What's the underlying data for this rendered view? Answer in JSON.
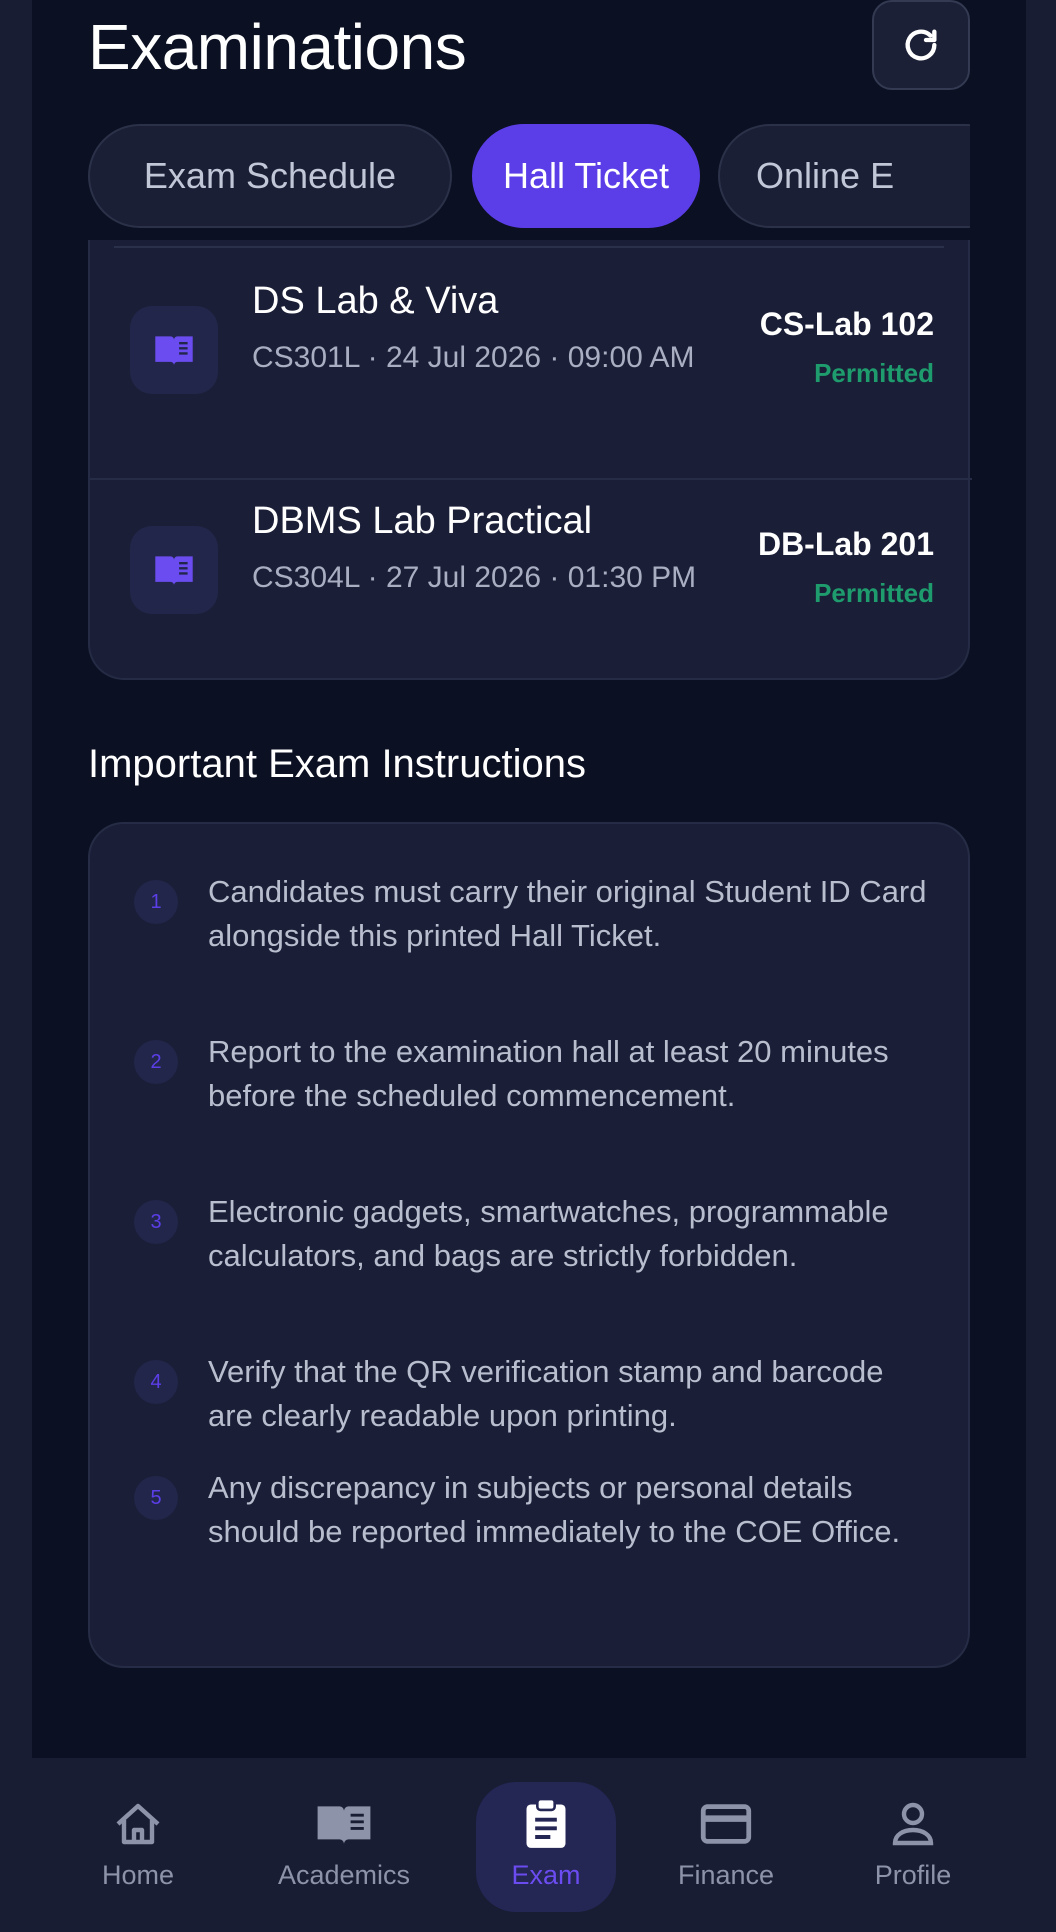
{
  "header": {
    "title": "Examinations",
    "refresh_icon": "refresh-icon"
  },
  "tabs": [
    {
      "label": "Exam Schedule",
      "active": false
    },
    {
      "label": "Hall Ticket",
      "active": true
    },
    {
      "label": "Online E",
      "active": false
    }
  ],
  "exams": [
    {
      "name": "DS Lab & Viva",
      "meta": "CS301L · 24 Jul 2026 · 09:00 AM",
      "room": "CS-Lab 102",
      "status": "Permitted",
      "icon": "book-icon"
    },
    {
      "name": "DBMS Lab Practical",
      "meta": "CS304L · 27 Jul 2026 · 01:30 PM",
      "room": "DB-Lab 201",
      "status": "Permitted",
      "icon": "book-icon"
    }
  ],
  "instructions": {
    "title": "Important Exam Instructions",
    "items": [
      {
        "num": "1",
        "text": "Candidates must carry their original Student ID Card alongside this printed Hall Ticket."
      },
      {
        "num": "2",
        "text": "Report to the examination hall at least 20 minutes before the scheduled commencement."
      },
      {
        "num": "3",
        "text": "Electronic gadgets, smartwatches, programmable calculators, and bags are strictly forbidden."
      },
      {
        "num": "4",
        "text": "Verify that the QR verification stamp and barcode are clearly readable upon printing."
      },
      {
        "num": "5",
        "text": "Any discrepancy in subjects or personal details should be reported immediately to the COE Office."
      }
    ]
  },
  "nav": [
    {
      "label": "Home",
      "icon": "home-icon",
      "active": false
    },
    {
      "label": "Academics",
      "icon": "book-icon",
      "active": false
    },
    {
      "label": "Exam",
      "icon": "clipboard-icon",
      "active": true
    },
    {
      "label": "Finance",
      "icon": "card-icon",
      "active": false
    },
    {
      "label": "Profile",
      "icon": "user-icon",
      "active": false
    }
  ],
  "colors": {
    "accent": "#5b3ee8",
    "permitted": "#1e9c6e",
    "background": "#0b1022",
    "card": "#1a1e36"
  }
}
